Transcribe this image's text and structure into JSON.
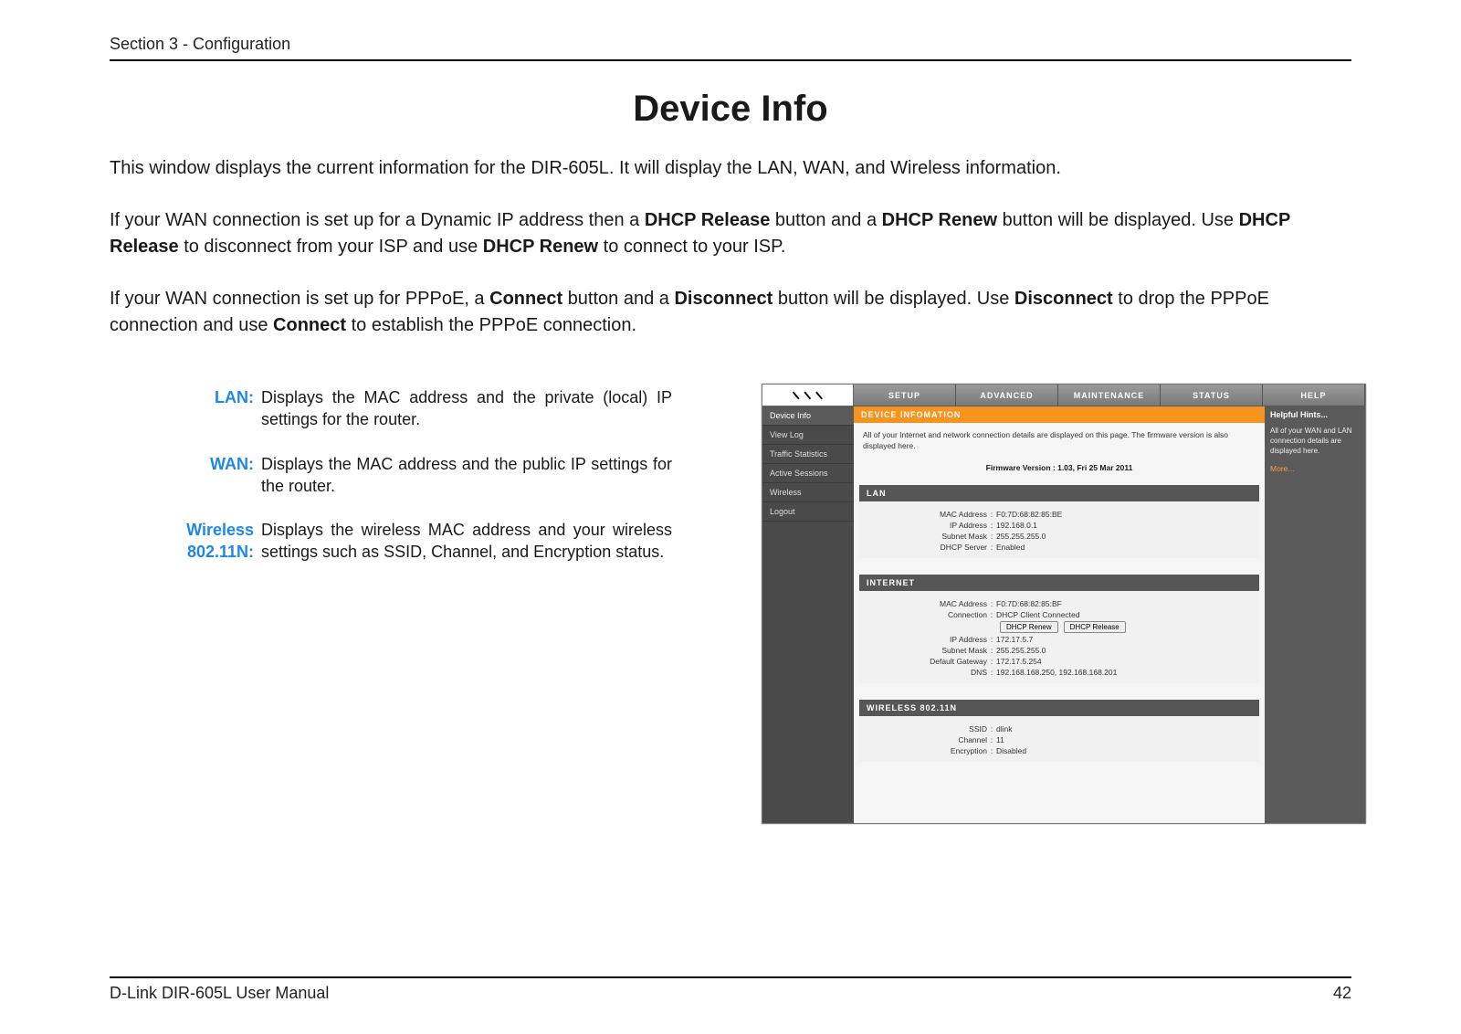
{
  "header": {
    "section": "Section 3 - Configuration"
  },
  "title": "Device Info",
  "paragraphs": {
    "p1": "This window displays the current information for the DIR-605L. It will display the LAN, WAN, and Wireless information.",
    "p2a": "If your WAN connection is set up for a Dynamic IP address then a ",
    "p2b": "DHCP Release",
    "p2c": " button and a ",
    "p2d": "DHCP Renew",
    "p2e": " button will be displayed. Use ",
    "p2f": "DHCP Release",
    "p2g": " to disconnect from your ISP and use ",
    "p2h": "DHCP Renew",
    "p2i": " to connect to your ISP.",
    "p3a": "If your WAN connection is set up for PPPoE, a ",
    "p3b": "Connect",
    "p3c": " button and a ",
    "p3d": "Disconnect",
    "p3e": " button will be displayed. Use ",
    "p3f": "Disconnect",
    "p3g": " to drop the PPPoE connection and use ",
    "p3h": "Connect",
    "p3i": " to establish the PPPoE connection."
  },
  "defs": {
    "lan": {
      "label": "LAN:",
      "text": "Displays the MAC address and the private (local) IP settings for the router."
    },
    "wan": {
      "label": "WAN:",
      "text": "Displays the MAC address and the public IP settings for the router."
    },
    "wlan": {
      "label": "Wireless 802.11N:",
      "text": "Displays the wireless MAC address and your wireless settings such as SSID, Channel, and Encryption status."
    }
  },
  "footer": {
    "left": "D-Link DIR-605L User Manual",
    "right": "42"
  },
  "router": {
    "tabs": [
      "SETUP",
      "ADVANCED",
      "MAINTENANCE",
      "STATUS",
      "HELP"
    ],
    "sidebar": [
      "Device Info",
      "View Log",
      "Traffic Statistics",
      "Active Sessions",
      "Wireless",
      "Logout"
    ],
    "orange": "DEVICE INFOMATION",
    "desc": "All of your Internet and network connection details are displayed on this page. The firmware version is also displayed here.",
    "fw_label": "Firmware Version :",
    "fw_value": "1.03,  Fri 25 Mar 2011",
    "panels": {
      "lan": {
        "title": "LAN",
        "rows": [
          {
            "k": "MAC Address",
            "v": "F0:7D:68:82:85:BE"
          },
          {
            "k": "IP Address",
            "v": "192.168.0.1"
          },
          {
            "k": "Subnet Mask",
            "v": "255.255.255.0"
          },
          {
            "k": "DHCP Server",
            "v": "Enabled"
          }
        ]
      },
      "internet": {
        "title": "INTERNET",
        "rows_top": [
          {
            "k": "MAC Address",
            "v": "F0:7D:68:82:85:BF"
          }
        ],
        "conn_label": "Connection",
        "conn_status": "DHCP Client Connected",
        "btn_renew": "DHCP Renew",
        "btn_release": "DHCP Release",
        "rows_bottom": [
          {
            "k": "IP Address",
            "v": "172.17.5.7"
          },
          {
            "k": "Subnet Mask",
            "v": "255.255.255.0"
          },
          {
            "k": "Default Gateway",
            "v": "172.17.5.254"
          },
          {
            "k": "DNS",
            "v": "192.168.168.250, 192.168.168.201"
          }
        ]
      },
      "wlan": {
        "title": "WIRELESS 802.11N",
        "rows": [
          {
            "k": "SSID",
            "v": "dlink"
          },
          {
            "k": "Channel",
            "v": "11"
          },
          {
            "k": "Encryption",
            "v": "Disabled"
          }
        ]
      }
    },
    "hints": {
      "title": "Helpful Hints...",
      "body": "All of your WAN and LAN connection details are displayed here.",
      "more": "More..."
    }
  }
}
